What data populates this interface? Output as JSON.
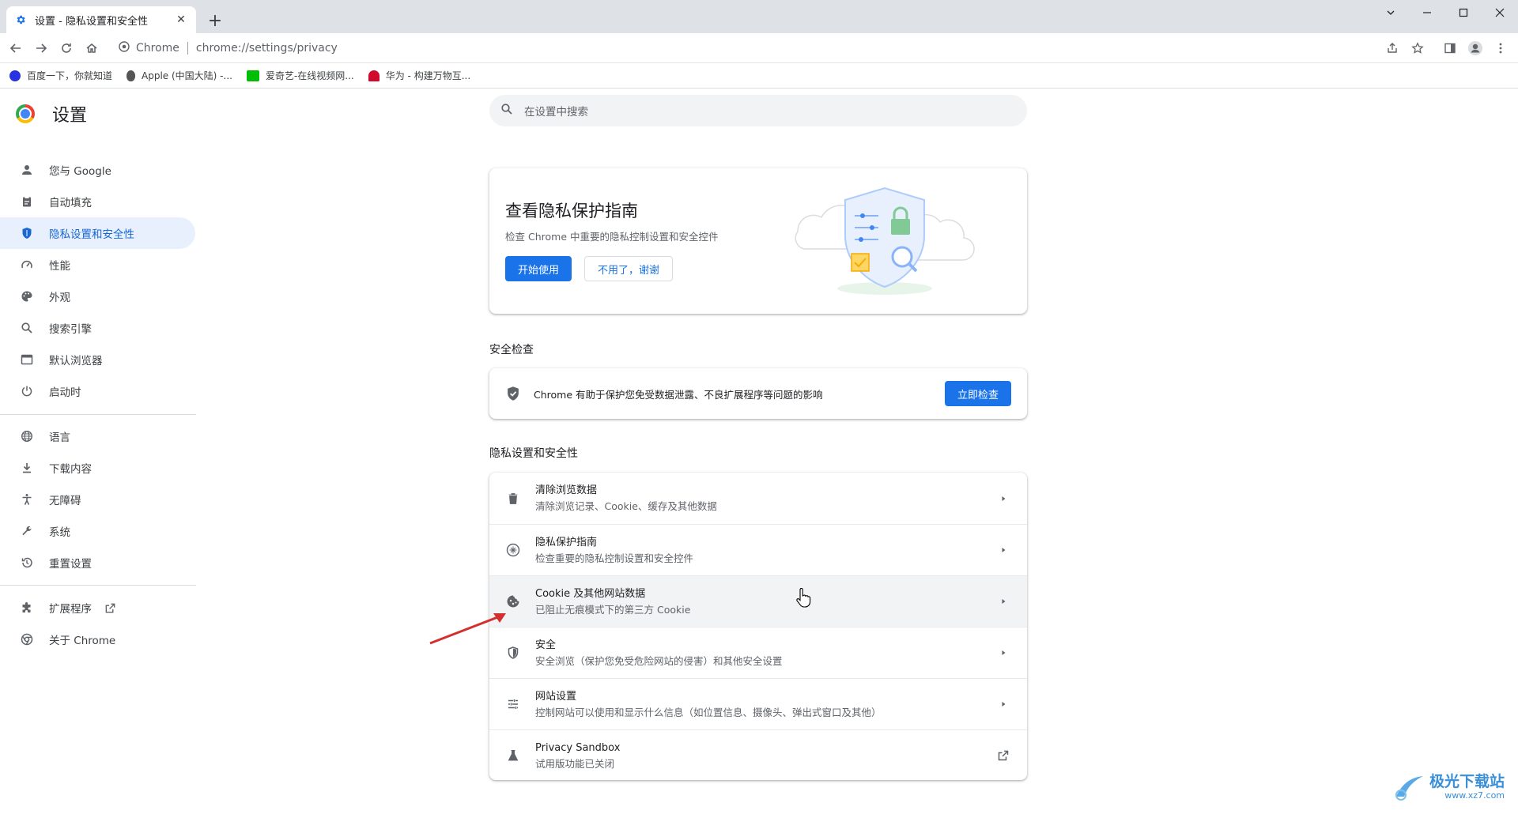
{
  "browser": {
    "tab_title": "设置 - 隐私设置和安全性",
    "omnibox_chip": "Chrome",
    "url": "chrome://settings/privacy"
  },
  "bookmarks": [
    {
      "label": "百度一下，你就知道",
      "color": "#2932e1"
    },
    {
      "label": "Apple (中国大陆) -...",
      "color": "#555555"
    },
    {
      "label": "爱奇艺-在线视频网...",
      "color": "#00be06"
    },
    {
      "label": "华为 - 构建万物互...",
      "color": "#cf0a2c"
    }
  ],
  "sidebar": {
    "title": "设置",
    "items": [
      {
        "label": "您与 Google",
        "icon": "person-icon"
      },
      {
        "label": "自动填充",
        "icon": "clipboard-icon"
      },
      {
        "label": "隐私设置和安全性",
        "icon": "shield-icon"
      },
      {
        "label": "性能",
        "icon": "gauge-icon"
      },
      {
        "label": "外观",
        "icon": "palette-icon"
      },
      {
        "label": "搜索引擎",
        "icon": "search-icon"
      },
      {
        "label": "默认浏览器",
        "icon": "browser-icon"
      },
      {
        "label": "启动时",
        "icon": "power-icon"
      },
      {
        "label": "语言",
        "icon": "globe-icon"
      },
      {
        "label": "下载内容",
        "icon": "download-icon"
      },
      {
        "label": "无障碍",
        "icon": "accessibility-icon"
      },
      {
        "label": "系统",
        "icon": "wrench-icon"
      },
      {
        "label": "重置设置",
        "icon": "history-icon"
      },
      {
        "label": "扩展程序",
        "icon": "puzzle-icon"
      },
      {
        "label": "关于 Chrome",
        "icon": "chrome-icon"
      }
    ]
  },
  "search": {
    "placeholder": "在设置中搜索"
  },
  "promo": {
    "title": "查看隐私保护指南",
    "description": "检查 Chrome 中重要的隐私控制设置和安全控件",
    "start_label": "开始使用",
    "dismiss_label": "不用了，谢谢"
  },
  "safety_check": {
    "section_title": "安全检查",
    "text": "Chrome 有助于保护您免受数据泄露、不良扩展程序等问题的影响",
    "button_label": "立即检查"
  },
  "privacy": {
    "section_title": "隐私设置和安全性",
    "rows": [
      {
        "title": "清除浏览数据",
        "subtitle": "清除浏览记录、Cookie、缓存及其他数据",
        "icon": "trash-icon"
      },
      {
        "title": "隐私保护指南",
        "subtitle": "检查重要的隐私控制设置和安全控件",
        "icon": "compass-icon"
      },
      {
        "title": "Cookie 及其他网站数据",
        "subtitle": "已阻止无痕模式下的第三方 Cookie",
        "icon": "cookie-icon"
      },
      {
        "title": "安全",
        "subtitle": "安全浏览（保护您免受危险网站的侵害）和其他安全设置",
        "icon": "security-shield-icon"
      },
      {
        "title": "网站设置",
        "subtitle": "控制网站可以使用和显示什么信息（如位置信息、摄像头、弹出式窗口及其他）",
        "icon": "tune-icon"
      },
      {
        "title": "Privacy Sandbox",
        "subtitle": "试用版功能已关闭",
        "icon": "flask-icon"
      }
    ]
  },
  "watermark": {
    "name": "极光下载站",
    "url": "www.xz7.com"
  },
  "colors": {
    "accent": "#1a73e8",
    "active_bg": "#e8f0fe",
    "annotation_arrow": "#d32f2f"
  }
}
